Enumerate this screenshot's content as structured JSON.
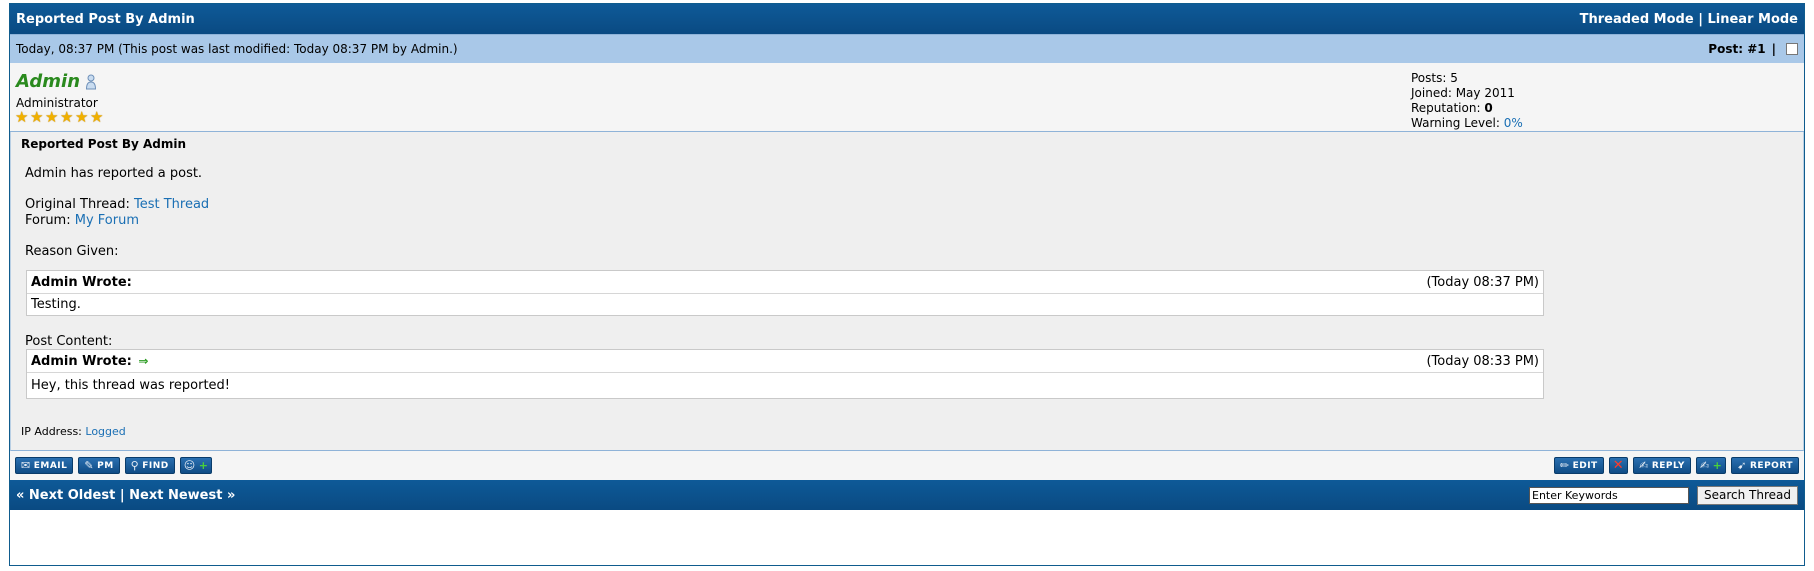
{
  "thread": {
    "title": "Reported Post By Admin",
    "modes": {
      "threaded": "Threaded Mode",
      "separator": "|",
      "linear": "Linear Mode"
    }
  },
  "post": {
    "meta_text": "Today, 08:37 PM (This post was last modified: Today 08:37 PM by Admin.)",
    "number_label": "Post: #1",
    "separator": "|"
  },
  "author": {
    "name": "Admin",
    "title": "Administrator",
    "stars": 6,
    "stats": {
      "posts_label": "Posts:",
      "posts": "5",
      "joined_label": "Joined:",
      "joined": "May 2011",
      "reputation_label": "Reputation:",
      "reputation": "0",
      "warning_label": "Warning Level:",
      "warning": "0%"
    }
  },
  "content": {
    "subject": "Reported Post By Admin",
    "intro": "Admin has reported a post.",
    "original_thread_label": "Original Thread:",
    "original_thread_link": "Test Thread",
    "forum_label": "Forum:",
    "forum_link": "My Forum",
    "reason_label": "Reason Given:",
    "reason_quote": {
      "author": "Admin Wrote:",
      "date": "(Today 08:37 PM)",
      "text": "Testing."
    },
    "content_label": "Post Content:",
    "content_quote": {
      "author": "Admin Wrote:",
      "date": "(Today 08:33 PM)",
      "text": "Hey, this thread was reported!"
    },
    "ip_label": "IP Address:",
    "ip_value": "Logged"
  },
  "buttons": {
    "left": {
      "email": "EMAIL",
      "pm": "PM",
      "find": "FIND"
    },
    "right": {
      "edit": "EDIT",
      "reply": "REPLY",
      "report": "REPORT"
    }
  },
  "footer": {
    "next_oldest": "« Next Oldest",
    "separator": "|",
    "next_newest": "Next Newest »",
    "search_placeholder": "Enter Keywords",
    "search_value": "Enter Keywords",
    "search_button": "Search Thread"
  },
  "colors": {
    "header_blue": "#0e5a98",
    "meta_blue": "#a9c8e8",
    "username_green": "#2a8a1e",
    "link_blue": "#1a6fb4"
  }
}
